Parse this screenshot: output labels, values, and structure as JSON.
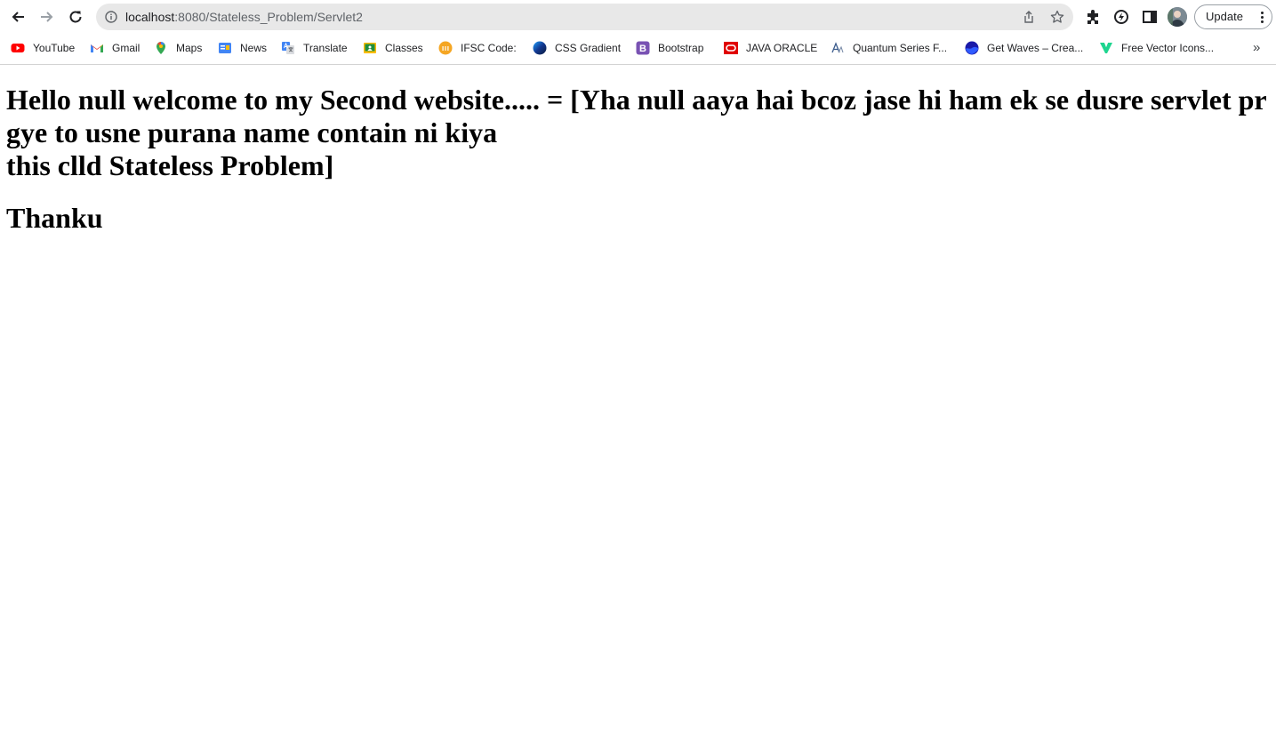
{
  "browser": {
    "url_host": "localhost",
    "url_path": ":8080/Stateless_Problem/Servlet2",
    "update_label": "Update"
  },
  "bookmarks": [
    {
      "label": "YouTube",
      "icon": "youtube-icon"
    },
    {
      "label": "Gmail",
      "icon": "gmail-icon"
    },
    {
      "label": "Maps",
      "icon": "maps-icon"
    },
    {
      "label": "News",
      "icon": "news-icon"
    },
    {
      "label": "Translate",
      "icon": "translate-icon"
    },
    {
      "label": "Classes",
      "icon": "classroom-icon"
    },
    {
      "label": "IFSC Code:",
      "icon": "ifsc-icon"
    },
    {
      "label": "CSS Gradient",
      "icon": "css-gradient-icon"
    },
    {
      "label": "Bootstrap",
      "icon": "bootstrap-icon"
    },
    {
      "label": "JAVA ORACLE",
      "icon": "oracle-icon"
    },
    {
      "label": "Quantum Series F...",
      "icon": "quantum-icon"
    },
    {
      "label": "Get Waves – Crea...",
      "icon": "waves-icon"
    },
    {
      "label": "Free Vector Icons...",
      "icon": "vector-icon"
    }
  ],
  "page": {
    "line1": "Hello null welcome to my Second website..... = [Yha null aaya hai bcoz jase hi ham ek se dusre servlet pr",
    "line2": "gye to usne purana name contain ni kiya",
    "line3": "this clld Stateless Problem]",
    "thanks": "Thanku"
  },
  "colors": {
    "omnibox_bg": "#e8e8e8",
    "youtube": "#ff0000",
    "bootstrap": "#7952b3",
    "oracle": "#e00000",
    "ifsc": "#f5a623"
  }
}
